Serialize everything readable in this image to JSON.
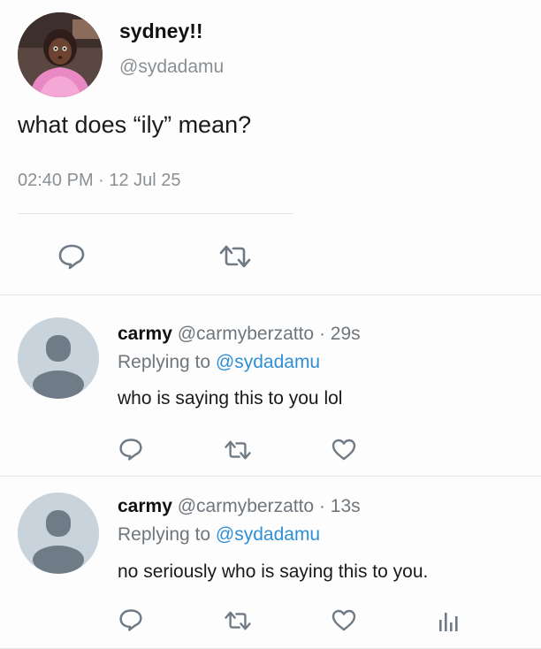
{
  "main_tweet": {
    "display_name": "sydney!!",
    "handle": "@sydadamu",
    "text": "what does “ily” mean?",
    "timestamp": "02:40 PM · 12 Jul 25"
  },
  "replies": [
    {
      "name": "carmy",
      "handle": "@carmyberzatto",
      "separator": "·",
      "time": "29s",
      "replying_label": "Replying to",
      "replying_to": "@sydadamu",
      "text": "who is saying this to you lol"
    },
    {
      "name": "carmy",
      "handle": "@carmyberzatto",
      "separator": "·",
      "time": "13s",
      "replying_label": "Replying to",
      "replying_to": "@sydadamu",
      "text": "no seriously who is saying this to you."
    }
  ],
  "icons": [
    "reply-icon",
    "retweet-icon",
    "like-icon",
    "analytics-icon"
  ],
  "colors": {
    "mention": "#2f8fd6",
    "muted": "#8a8f94",
    "icon": "#6f7a85",
    "default_avatar": "#c9d3db"
  }
}
